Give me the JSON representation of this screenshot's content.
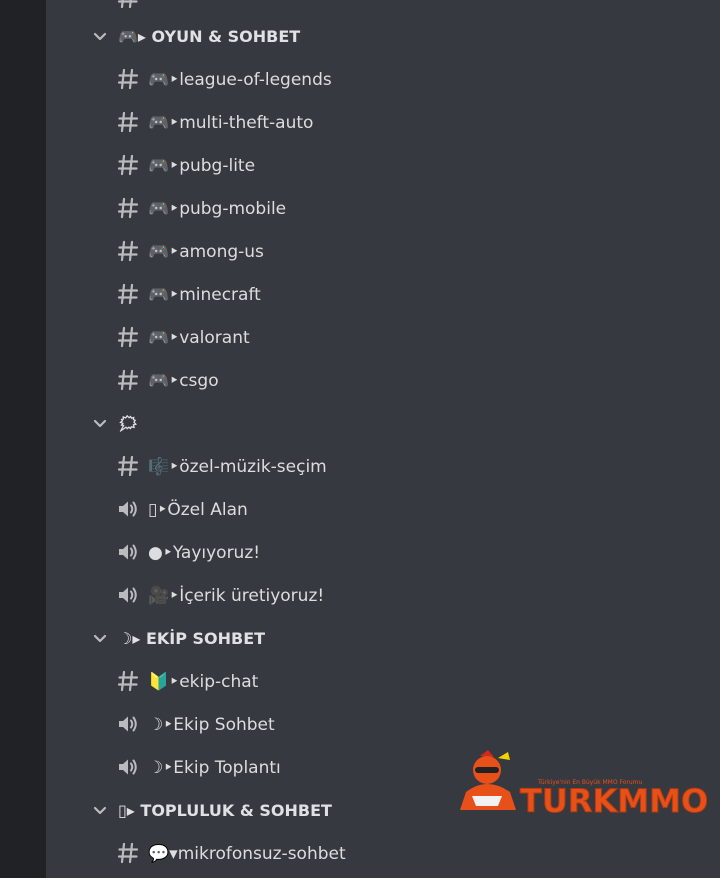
{
  "colors": {
    "server_rail": "#202225",
    "channel_list_bg": "#36393f",
    "channel_text": "#dcddde",
    "category_text": "#e0e1e5",
    "icon": "#b9bbbe",
    "logo_orange": "#e8501a"
  },
  "channels": [
    {
      "kind": "category",
      "label": "🎮▸ OYUN & SOHBET",
      "icon": "chevron-down-icon"
    },
    {
      "kind": "text",
      "label": "🎮‣league-of-legends",
      "icon": "hash-icon"
    },
    {
      "kind": "text",
      "label": "🎮‣multi-theft-auto",
      "icon": "hash-icon"
    },
    {
      "kind": "text",
      "label": "🎮‣pubg-lite",
      "icon": "hash-icon"
    },
    {
      "kind": "text",
      "label": "🎮‣pubg-mobile",
      "icon": "hash-icon"
    },
    {
      "kind": "text",
      "label": "🎮‣among-us",
      "icon": "hash-icon"
    },
    {
      "kind": "text",
      "label": "🎮‣minecraft",
      "icon": "hash-icon"
    },
    {
      "kind": "text",
      "label": "🎮‣valorant",
      "icon": "hash-icon"
    },
    {
      "kind": "text",
      "label": "🎮‣csgo",
      "icon": "hash-icon"
    },
    {
      "kind": "category",
      "label": "🗯",
      "icon": "chevron-down-icon"
    },
    {
      "kind": "text",
      "label": "🎼‣özel-müzik-seçim",
      "icon": "hash-icon"
    },
    {
      "kind": "voice",
      "label": "▯‣Özel Alan",
      "icon": "speaker-icon"
    },
    {
      "kind": "voice",
      "label": "●‣Yayıyoruz!",
      "icon": "speaker-icon"
    },
    {
      "kind": "voice",
      "label": "🎥‣İçerik üretiyoruz!",
      "icon": "speaker-icon"
    },
    {
      "kind": "category",
      "label": "☽▸ EKİP SOHBET",
      "icon": "chevron-down-icon"
    },
    {
      "kind": "text",
      "label": "🔰‣ekip-chat",
      "icon": "hash-icon"
    },
    {
      "kind": "voice",
      "label": "☽‣Ekip Sohbet",
      "icon": "speaker-icon"
    },
    {
      "kind": "voice",
      "label": "☽‣Ekip Toplantı",
      "icon": "speaker-icon"
    },
    {
      "kind": "category",
      "label": "▯▸ TOPLULUK & SOHBET",
      "icon": "chevron-down-icon"
    },
    {
      "kind": "text",
      "label": "💬▾mikrofonsuz-sohbet",
      "icon": "hash-icon"
    }
  ],
  "watermark": {
    "brand": "TURKMMO",
    "tagline": "Türkiye'nin En Büyük MMO Forumu"
  }
}
